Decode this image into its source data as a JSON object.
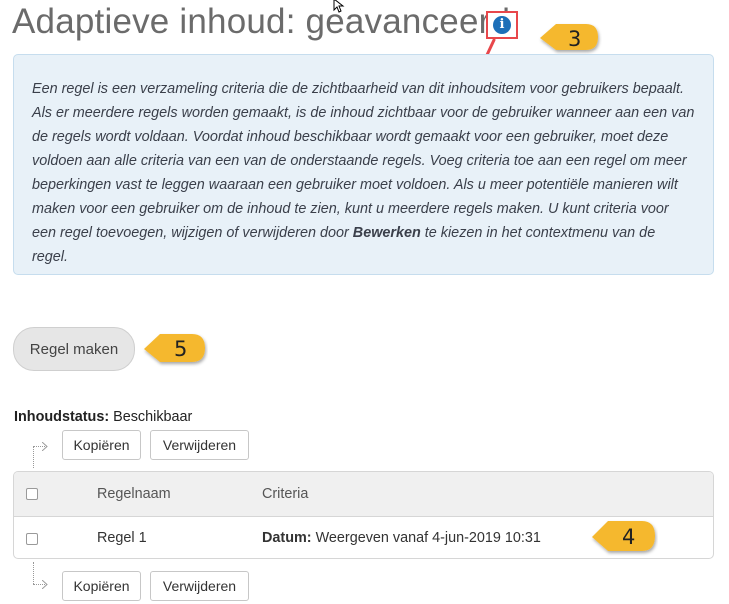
{
  "header": {
    "title": "Adaptieve inhoud: geavanceerd",
    "info_icon_glyph": "i"
  },
  "callouts": {
    "c3": "3",
    "c4": "4",
    "c5": "5",
    "color": "#f5b82e"
  },
  "info": {
    "text_before": "Een regel is een verzameling criteria die de zichtbaarheid van dit inhoudsitem voor gebruikers bepaalt. Als er meerdere regels worden gemaakt, is de inhoud zichtbaar voor de gebruiker wanneer aan een van de regels wordt voldaan. Voordat inhoud beschikbaar wordt gemaakt voor een gebruiker, moet deze voldoen aan alle criteria van een van de onderstaande regels. Voeg criteria toe aan een regel om meer beperkingen vast te leggen waaraan een gebruiker moet voldoen. Als u meer potentiële manieren wilt maken voor een gebruiker om de inhoud te zien, kunt u meerdere regels maken. U kunt criteria voor een regel toevoegen, wijzigen of verwijderen door ",
    "bold": "Bewerken",
    "text_after": " te kiezen in het contextmenu van de regel."
  },
  "actions": {
    "create_rule": "Regel maken"
  },
  "status": {
    "label": "Inhoudstatus:",
    "value": " Beschikbaar"
  },
  "toolbar_top": {
    "copy": "Kopiëren",
    "delete": "Verwijderen"
  },
  "toolbar_bottom": {
    "copy": "Kopiëren",
    "delete": "Verwijderen"
  },
  "table": {
    "headers": {
      "name": "Regelnaam",
      "criteria": "Criteria"
    },
    "rows": [
      {
        "name": "Regel 1",
        "criteria_label": "Datum:",
        "criteria_value": " Weergeven vanaf 4-jun-2019 10:31"
      }
    ]
  }
}
